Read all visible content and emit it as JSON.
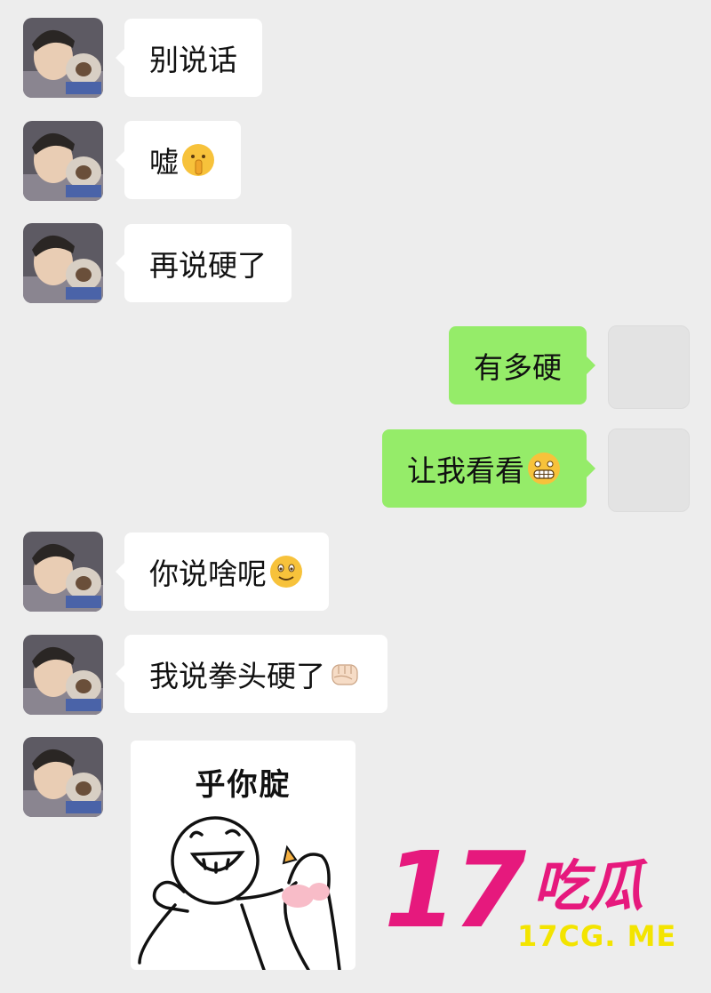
{
  "messages": [
    {
      "side": "in",
      "text": "别说话",
      "emoji": ""
    },
    {
      "side": "in",
      "text": "嘘",
      "emoji": "shushing-face"
    },
    {
      "side": "in",
      "text": "再说硬了",
      "emoji": ""
    },
    {
      "side": "out",
      "text": "有多硬",
      "emoji": ""
    },
    {
      "side": "out",
      "text": "让我看看",
      "emoji": "grimacing-face"
    },
    {
      "side": "in",
      "text": "你说啥呢",
      "emoji": "smiling-face"
    },
    {
      "side": "in",
      "text": "我说拳头硬了",
      "emoji": "fist"
    }
  ],
  "sticker": {
    "caption": "乎你腚"
  },
  "watermark": {
    "brand_number": "17",
    "brand_text": "吃瓜",
    "site": "17CG. ME",
    "color": "#e6197d",
    "site_color": "#f3e400"
  },
  "colors": {
    "background": "#ededed",
    "incoming_bubble": "#ffffff",
    "outgoing_bubble": "#95ec69"
  }
}
